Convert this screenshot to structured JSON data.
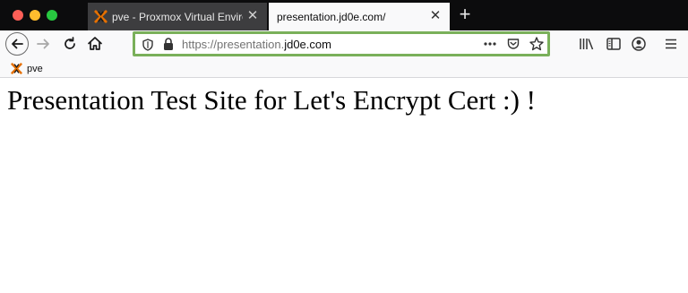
{
  "tabs": [
    {
      "title": "pve - Proxmox Virtual Environment",
      "close": "✕",
      "active": false
    },
    {
      "title": "presentation.jd0e.com/",
      "close": "✕",
      "active": true
    }
  ],
  "new_tab": "+",
  "address_bar": {
    "scheme": "https://",
    "subdomain": "presentation.",
    "domain": "jd0e.com",
    "highlight_color": "#7ab05a"
  },
  "bookmarks": [
    {
      "label": "pve",
      "icon": "proxmox-icon"
    }
  ],
  "page": {
    "heading": "Presentation Test Site for Let's Encrypt Cert :) !"
  },
  "icons": {
    "back": "back-arrow-icon",
    "forward": "forward-arrow-icon",
    "reload": "reload-icon",
    "home": "home-icon",
    "shield": "tracking-protection-icon",
    "lock": "lock-icon",
    "more": "more-actions-icon",
    "pocket": "pocket-icon",
    "star": "bookmark-star-icon",
    "library": "library-icon",
    "sidebar": "sidebar-icon",
    "account": "account-icon",
    "menu": "hamburger-menu-icon"
  }
}
